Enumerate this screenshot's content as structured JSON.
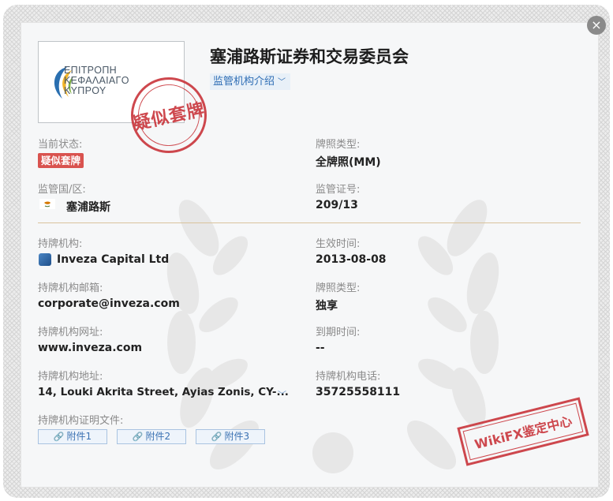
{
  "title": "塞浦路斯证券和交易委员会",
  "intro_label": "监管机构介绍",
  "logo": {
    "line1": "ΕΠΙΤΡΟΠΗ",
    "line2": "ΚΕΦΑΛΑΙΑΓΟ",
    "line3": "ΚΥΠΡΟΥ"
  },
  "seal_text": "疑似套牌",
  "status": {
    "label": "当前状态:",
    "value": "疑似套牌"
  },
  "license_type": {
    "label": "牌照类型:",
    "value": "全牌照(MM)"
  },
  "region": {
    "label": "监管国/区:",
    "value": "塞浦路斯"
  },
  "license_no": {
    "label": "监管证号:",
    "value": "209/13"
  },
  "holder": {
    "label": "持牌机构:",
    "value": "Inveza Capital Ltd"
  },
  "effective": {
    "label": "生效时间:",
    "value": "2013-08-08"
  },
  "email": {
    "label": "持牌机构邮箱:",
    "value": "corporate@inveza.com"
  },
  "license_type2": {
    "label": "牌照类型:",
    "value": "独享"
  },
  "website": {
    "label": "持牌机构网址:",
    "value": "www.inveza.com"
  },
  "expiry": {
    "label": "到期时间:",
    "value": "--"
  },
  "address": {
    "label": "持牌机构地址:",
    "value": "14, Louki Akrita Street, Ayias Zonis, CY-..."
  },
  "phone": {
    "label": "持牌机构电话:",
    "value": "35725558111"
  },
  "documents": {
    "label": "持牌机构证明文件:",
    "items": [
      "附件1",
      "附件2",
      "附件3"
    ]
  },
  "stamp_text": "WikiFX鉴定中心",
  "colors": {
    "accent": "#2e6db4",
    "warning": "#d9534f",
    "divider": "#d9c39c"
  }
}
